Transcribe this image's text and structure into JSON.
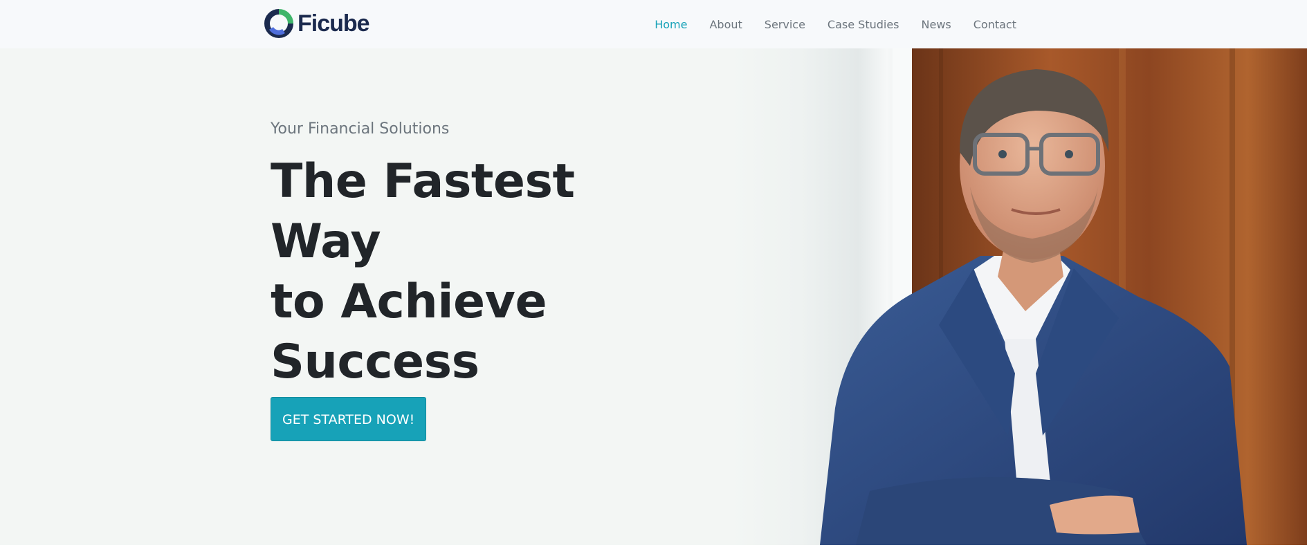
{
  "brand": {
    "name": "Ficube",
    "logo_icon": "ficube-logo-icon",
    "colors": {
      "navy": "#1b2a4e",
      "blue": "#4f6edb",
      "green": "#3fb56a"
    }
  },
  "nav": {
    "items": [
      {
        "label": "Home",
        "active": true
      },
      {
        "label": "About",
        "active": false
      },
      {
        "label": "Service",
        "active": false
      },
      {
        "label": "Case Studies",
        "active": false
      },
      {
        "label": "News",
        "active": false
      },
      {
        "label": "Contact",
        "active": false
      }
    ],
    "active_color": "#17a2b8"
  },
  "hero": {
    "eyebrow": "Your Financial Solutions",
    "headline_lines": [
      "The Fastest",
      "Way",
      "to Achieve",
      "Success"
    ],
    "cta_label": "GET STARTED NOW!",
    "cta_color": "#17a2b8",
    "image": "businessman-portrait-photo"
  }
}
